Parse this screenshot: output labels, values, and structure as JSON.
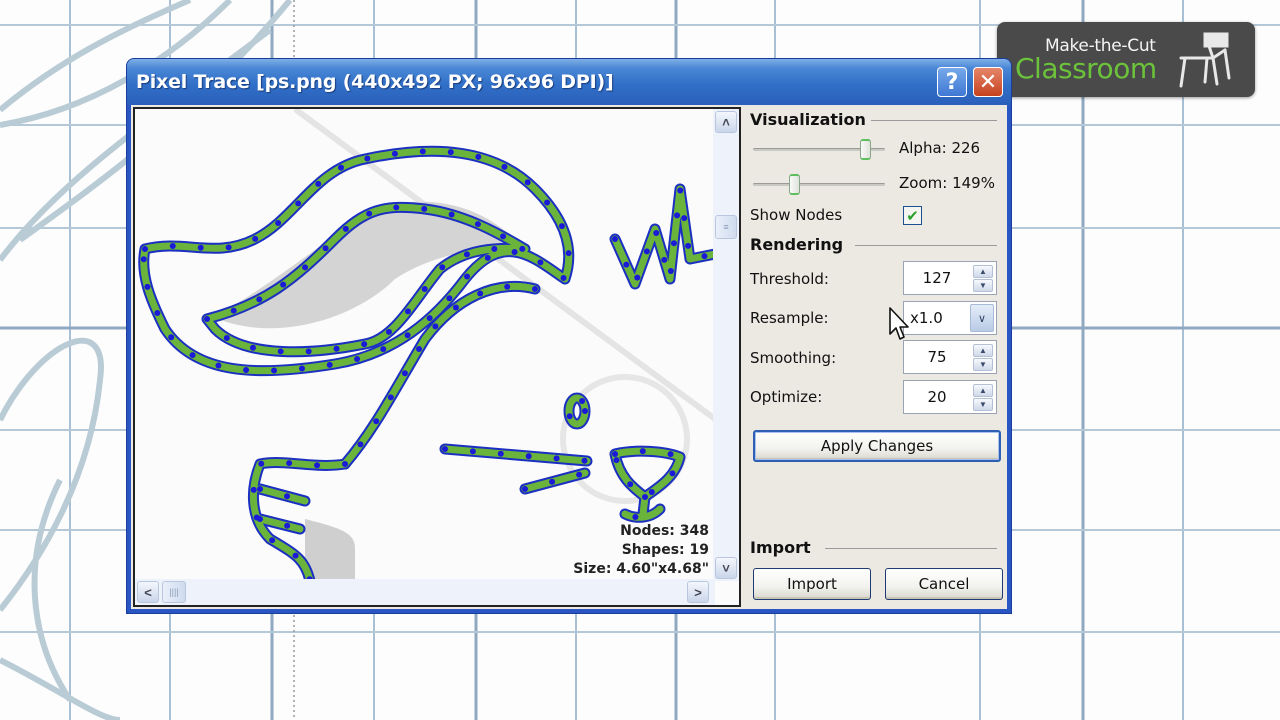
{
  "logo": {
    "line1": "Make-the-Cut",
    "line2": "Classroom",
    "icon": "school-desk-icon",
    "colors": {
      "background": "#4a4a4a",
      "accent": "#6cc23a"
    }
  },
  "dialog": {
    "title": "Pixel Trace [ps.png (440x492 PX; 96x96 DPI)]",
    "help_icon": "?",
    "close_icon": "✕",
    "preview": {
      "stats": {
        "nodes": "Nodes: 348",
        "shapes": "Shapes: 19",
        "size": "Size: 4.60\"x4.68\""
      },
      "scroll_up": "˄",
      "scroll_down": "˅",
      "scroll_left": "<",
      "scroll_right": ">",
      "thumb_grip": "||||"
    },
    "visualization": {
      "heading": "Visualization",
      "alpha_label": "Alpha: 226",
      "alpha_value": 226,
      "alpha_max": 255,
      "zoom_label": "Zoom: 149%",
      "zoom_fraction": 0.3,
      "show_nodes_label": "Show Nodes",
      "show_nodes_checked": true,
      "check_glyph": "✔"
    },
    "rendering": {
      "heading": "Rendering",
      "threshold_label": "Threshold:",
      "threshold_value": "127",
      "resample_label": "Resample:",
      "resample_value": "x1.0",
      "smoothing_label": "Smoothing:",
      "smoothing_value": "75",
      "optimize_label": "Optimize:",
      "optimize_value": "20",
      "spin_up": "▲",
      "spin_down": "▼",
      "combo_arrow": "∨",
      "apply_label": "Apply Changes"
    },
    "import": {
      "heading": "Import",
      "import_label": "Import",
      "cancel_label": "Cancel"
    }
  },
  "colors": {
    "trace_fill": "#6ab43c",
    "trace_outline": "#1b2fc2",
    "node": "#1a1ad8",
    "title_bar": "#3170c8"
  }
}
